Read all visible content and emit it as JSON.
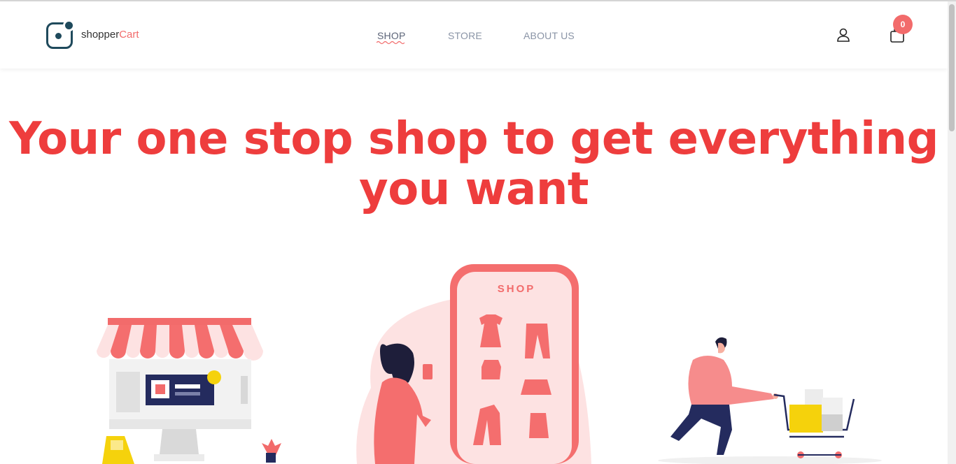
{
  "brand": {
    "name_part1": "shopper",
    "name_part2": "Cart"
  },
  "nav": {
    "items": [
      {
        "label": "SHOP",
        "active": true
      },
      {
        "label": "STORE",
        "active": false
      },
      {
        "label": "ABOUT US",
        "active": false
      }
    ]
  },
  "header_icons": {
    "user": "user-icon",
    "cart": "shopping-bag-icon"
  },
  "cart": {
    "count": "0"
  },
  "hero": {
    "title": "Your one stop shop to get everything you want"
  },
  "illustration": {
    "phone_label": "SHOP"
  },
  "colors": {
    "accent": "#ee3d3d",
    "coral": "#f26b6b",
    "navy": "#1f4a5c"
  }
}
